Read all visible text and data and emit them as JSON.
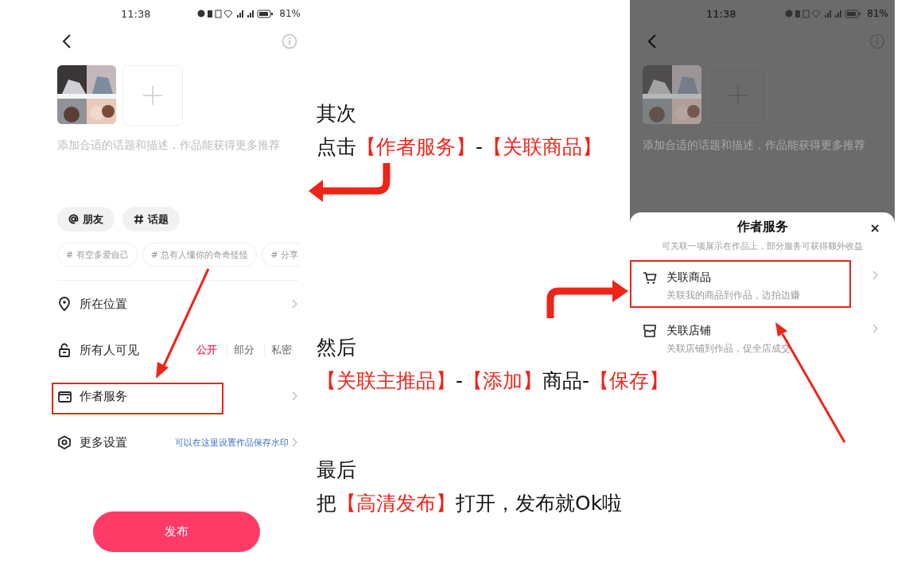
{
  "left_phone": {
    "status_bar": {
      "time": "11:38",
      "battery": "81%"
    },
    "placeholder": "添加合适的话题和描述，作品能获得更多推荐",
    "quick_tags": [
      "朋友",
      "话题"
    ],
    "topic_suggestions": [
      "# 有空多爱自己",
      "# 总有人懂你的奇奇怪怪",
      "# 分享"
    ],
    "settings": [
      {
        "kind": "link",
        "label": "所在位置",
        "highlighted": false
      },
      {
        "kind": "visibility",
        "label": "所有人可见",
        "options": [
          {
            "label": "公开",
            "selected": true
          },
          {
            "label": "部分",
            "selected": false
          },
          {
            "label": "私密",
            "selected": false
          }
        ]
      },
      {
        "kind": "link",
        "label": "作者服务",
        "highlighted": true
      },
      {
        "kind": "link",
        "label": "更多设置",
        "hint": "可以在这里设置作品保存水印",
        "highlighted": false
      }
    ],
    "publish_button": "发布"
  },
  "steps": [
    {
      "heading": "其次",
      "instruction": [
        {
          "text": "点击",
          "emphasis": false
        },
        {
          "text": "【作者服务】",
          "emphasis": true
        },
        {
          "text": "-",
          "emphasis": false
        },
        {
          "text": "【关联商品】",
          "emphasis": true
        }
      ]
    },
    {
      "heading": "然后",
      "instruction": [
        {
          "text": "【关联主推品】",
          "emphasis": true
        },
        {
          "text": "-",
          "emphasis": false
        },
        {
          "text": "【添加】",
          "emphasis": true
        },
        {
          "text": "商品-",
          "emphasis": false
        },
        {
          "text": "【保存】",
          "emphasis": true
        }
      ]
    },
    {
      "heading": "最后",
      "instruction": [
        {
          "text": "把",
          "emphasis": false
        },
        {
          "text": "【高清发布】",
          "emphasis": true
        },
        {
          "text": "打开，发布就Ok啦",
          "emphasis": false
        }
      ]
    }
  ],
  "right_phone": {
    "status_bar": {
      "time": "11:38",
      "battery": "81%"
    },
    "placeholder": "添加合适的话题和描述，作品能获得更多推荐",
    "sheet": {
      "title": "作者服务",
      "close": "×",
      "subtitle": "可关联一项展示在作品上，部分服务可获得额外收益",
      "items": [
        {
          "label": "关联商品",
          "description": "关联我的商品到作品，边拍边赚",
          "highlighted": true
        },
        {
          "label": "关联店铺",
          "description": "关联店铺到作品，促全店成交",
          "highlighted": false
        }
      ]
    }
  }
}
